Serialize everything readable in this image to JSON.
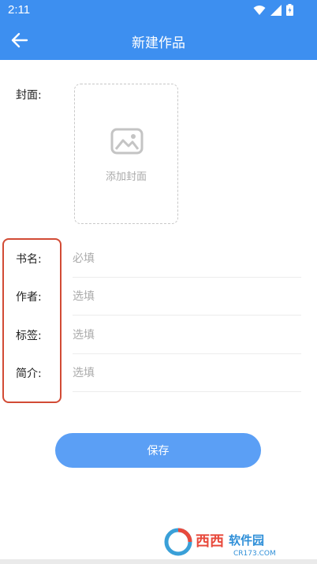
{
  "status": {
    "time": "2:11"
  },
  "header": {
    "title": "新建作品"
  },
  "cover": {
    "label": "封面:",
    "button_text": "添加封面"
  },
  "fields": [
    {
      "label": "书名:",
      "placeholder": "必填"
    },
    {
      "label": "作者:",
      "placeholder": "选填"
    },
    {
      "label": "标签:",
      "placeholder": "选填"
    },
    {
      "label": "简介:",
      "placeholder": "选填"
    }
  ],
  "save": {
    "label": "保存"
  },
  "watermark": {
    "brand": "西西软件园",
    "site": "CR173.COM"
  },
  "colors": {
    "primary": "#3d8ff0",
    "button": "#5b9ff5",
    "highlight": "#d24b35"
  },
  "icons": {
    "back": "arrow-left-icon",
    "cover": "image-icon"
  }
}
